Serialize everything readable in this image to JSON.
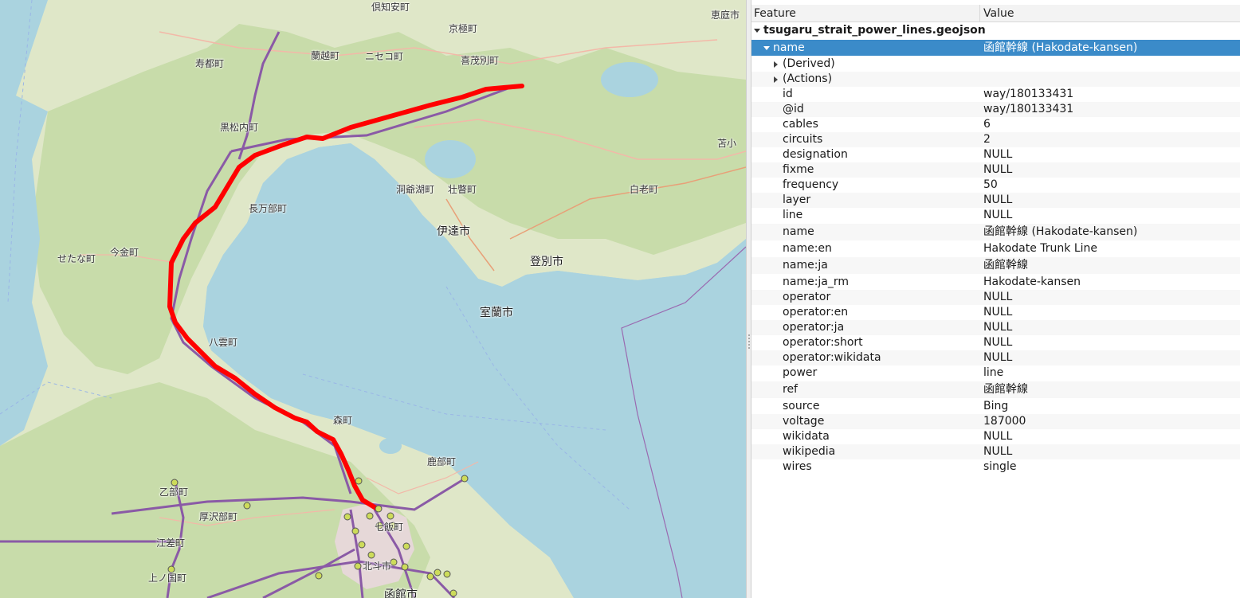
{
  "map": {
    "places": [
      {
        "id": "kutchan-north",
        "text": "倶知安町"
      },
      {
        "id": "kyogoku",
        "text": "京極町"
      },
      {
        "id": "eniwa",
        "text": "恵庭市"
      },
      {
        "id": "suttsu",
        "text": "寿都町"
      },
      {
        "id": "rankoshi",
        "text": "蘭越町"
      },
      {
        "id": "niseko",
        "text": "ニセコ町"
      },
      {
        "id": "kimobetsu",
        "text": "喜茂別町"
      },
      {
        "id": "kuromatsunai",
        "text": "黒松内町"
      },
      {
        "id": "tomakomai",
        "text": "苫小"
      },
      {
        "id": "toyako",
        "text": "洞爺湖町"
      },
      {
        "id": "sobetsu",
        "text": "壮瞥町"
      },
      {
        "id": "shiraoi",
        "text": "白老町"
      },
      {
        "id": "oshamambe",
        "text": "長万部町"
      },
      {
        "id": "date",
        "text": "伊達市"
      },
      {
        "id": "setana",
        "text": "せたな町"
      },
      {
        "id": "imakane",
        "text": "今金町"
      },
      {
        "id": "noboribetsu",
        "text": "登別市"
      },
      {
        "id": "muroran",
        "text": "室蘭市"
      },
      {
        "id": "yakumo",
        "text": "八雲町"
      },
      {
        "id": "mori",
        "text": "森町"
      },
      {
        "id": "shikabe",
        "text": "鹿部町"
      },
      {
        "id": "otobe",
        "text": "乙部町"
      },
      {
        "id": "assabu",
        "text": "厚沢部町"
      },
      {
        "id": "esashi",
        "text": "江差町"
      },
      {
        "id": "kaminokuni",
        "text": "上ノ国町"
      },
      {
        "id": "hakodate",
        "text": "函館市"
      },
      {
        "id": "nanae",
        "text": "七飯町"
      },
      {
        "id": "hokuto",
        "text": "北斗市"
      }
    ],
    "line_color": "#ff0000",
    "other_lines_color": "#8a5aa6",
    "node_color": "#cddc5a"
  },
  "panel": {
    "columns": {
      "feature": "Feature",
      "value": "Value"
    },
    "layer": "tsugaru_strait_power_lines.geojson",
    "selected": {
      "key": "name",
      "value": "函館幹線 (Hakodate-kansen)"
    },
    "groups": [
      "(Derived)",
      "(Actions)"
    ],
    "attributes": [
      {
        "key": "id",
        "value": "way/180133431"
      },
      {
        "key": "@id",
        "value": "way/180133431"
      },
      {
        "key": "cables",
        "value": "6"
      },
      {
        "key": "circuits",
        "value": "2"
      },
      {
        "key": "designation",
        "value": "NULL"
      },
      {
        "key": "fixme",
        "value": "NULL"
      },
      {
        "key": "frequency",
        "value": "50"
      },
      {
        "key": "layer",
        "value": "NULL"
      },
      {
        "key": "line",
        "value": "NULL"
      },
      {
        "key": "name",
        "value": "函館幹線 (Hakodate-kansen)"
      },
      {
        "key": "name:en",
        "value": "Hakodate Trunk Line"
      },
      {
        "key": "name:ja",
        "value": "函館幹線"
      },
      {
        "key": "name:ja_rm",
        "value": "Hakodate-kansen"
      },
      {
        "key": "operator",
        "value": "NULL"
      },
      {
        "key": "operator:en",
        "value": "NULL"
      },
      {
        "key": "operator:ja",
        "value": "NULL"
      },
      {
        "key": "operator:short",
        "value": "NULL"
      },
      {
        "key": "operator:wikidata",
        "value": "NULL"
      },
      {
        "key": "power",
        "value": "line"
      },
      {
        "key": "ref",
        "value": "函館幹線"
      },
      {
        "key": "source",
        "value": "Bing"
      },
      {
        "key": "voltage",
        "value": "187000"
      },
      {
        "key": "wikidata",
        "value": "NULL"
      },
      {
        "key": "wikipedia",
        "value": "NULL"
      },
      {
        "key": "wires",
        "value": "single"
      }
    ]
  }
}
